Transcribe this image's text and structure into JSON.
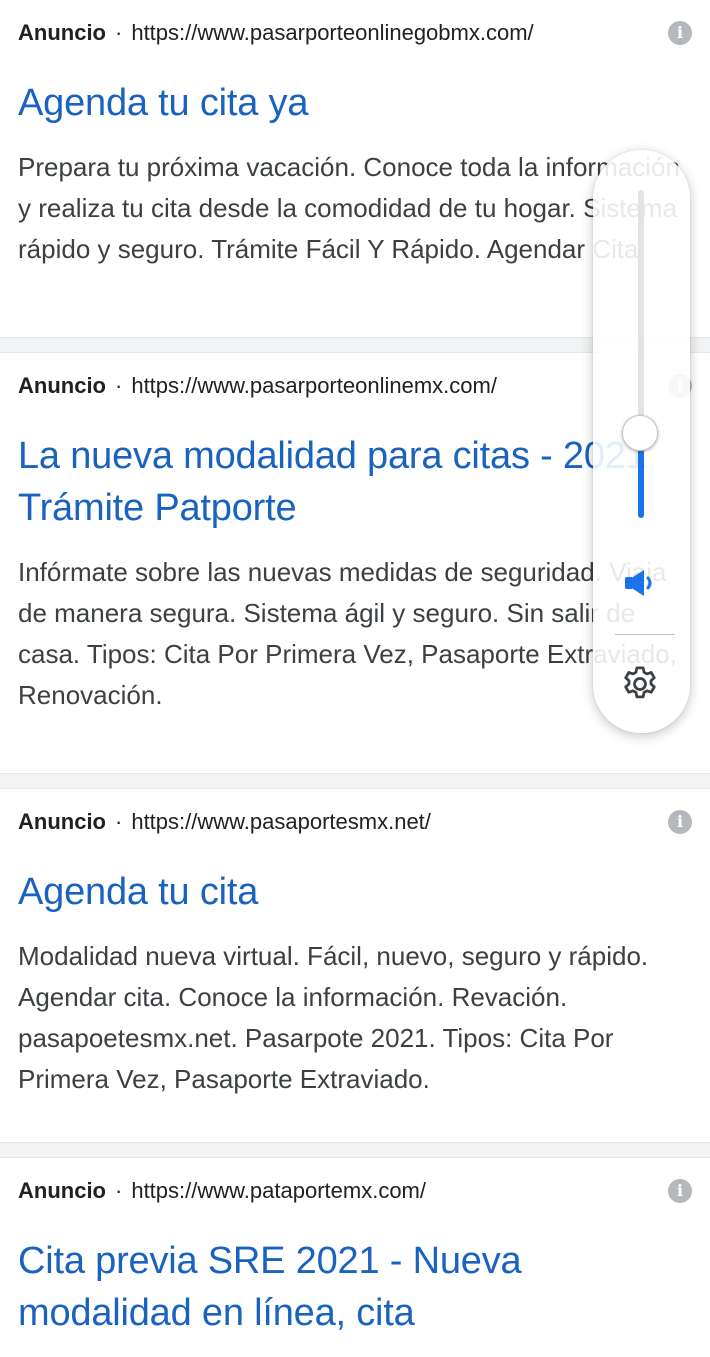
{
  "ads": [
    {
      "label": "Anuncio",
      "separator": "·",
      "url": "https://www.pasarporteonlinegobmx.com/",
      "title": "Agenda tu cita ya",
      "description": "Prepara tu próxima vacación. Conoce toda la información y realiza tu cita desde la comodidad de tu hogar. Sistema rápido y seguro. Trámite Fácil Y Rápido. Agendar Cita.",
      "info_icon": "info-icon"
    },
    {
      "label": "Anuncio",
      "separator": "·",
      "url": "https://www.pasarporteonlinemx.com/",
      "title": "La nueva modalidad para citas - 2021 Trámite Patporte",
      "description": "Infórmate sobre las nuevas medidas de seguridad. Viaja de manera segura. Sistema ágil y seguro. Sin salir de casa. Tipos: Cita Por Primera Vez, Pasaporte Extraviado, Renovación.",
      "info_icon": "info-icon"
    },
    {
      "label": "Anuncio",
      "separator": "·",
      "url": "https://www.pasaportesmx.net/",
      "title": "Agenda tu cita",
      "description": "Modalidad nueva virtual. Fácil, nuevo, seguro y rápido. Agendar cita. Conoce la información. Revación. pasapoetesmx.net. Pasarpote 2021. Tipos: Cita Por Primera Vez, Pasaporte Extraviado.",
      "info_icon": "info-icon"
    },
    {
      "label": "Anuncio",
      "separator": "·",
      "url": "https://www.pataportemx.com/",
      "title": "Cita previa SRE 2021 - Nueva modalidad en línea, cita",
      "description": "",
      "info_icon": "info-icon"
    }
  ],
  "volume_panel": {
    "level": 0.21,
    "speaker_icon": "speaker-icon",
    "settings_icon": "gear-icon",
    "accent_color": "#1a73e8"
  },
  "colors": {
    "title_link": "#1a62c0",
    "body_text": "#3c4043",
    "separator": "#f1f3f4"
  }
}
